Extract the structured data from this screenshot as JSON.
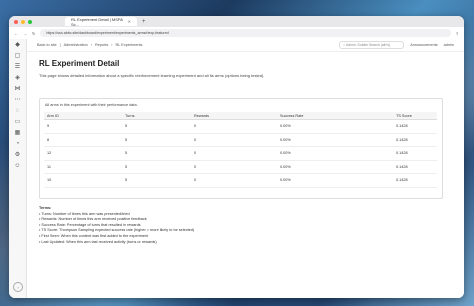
{
  "browser": {
    "tab_title": "RL Experiment Detail | MSPA Sc...",
    "url": "https://sso.abbc.site/dashboard/experiment/experiments_arms/rlexp-featured"
  },
  "nav": {
    "back": "Back to site",
    "breadcrumbs": [
      "Administration",
      "Reports",
      "RL Experiments"
    ],
    "search_placeholder": "Admin: Soldier Search (alt+s)",
    "announcements": "Announcements",
    "user": "admin"
  },
  "page": {
    "title": "RL Experiment Detail",
    "description": "This page shows detailed information about a specific reinforcement learning experiment and all its arms (options being tested)."
  },
  "arms": {
    "description": "All arms in this experiment with their performance data.",
    "columns": [
      "Arm ID",
      "Turns",
      "Rewards",
      "Success Rate",
      "TS Score"
    ],
    "rows": [
      [
        "9",
        "5",
        "0",
        "0.00%",
        "0.1428"
      ],
      [
        "8",
        "5",
        "0",
        "0.00%",
        "0.1428"
      ],
      [
        "12",
        "5",
        "0",
        "0.00%",
        "0.1428"
      ],
      [
        "11",
        "5",
        "0",
        "0.00%",
        "0.1428"
      ],
      [
        "10",
        "5",
        "0",
        "0.00%",
        "0.1428"
      ]
    ]
  },
  "terms": {
    "heading": "Terms:",
    "items": [
      "• Turns: Number of times this arm was presented/tried",
      "• Rewards: Number of times this arm received positive feedback",
      "• Success Rate: Percentage of turns that resulted in rewards",
      "• TS Score: Thompson Sampling expected success rate (higher = more likely to be selected)",
      "• First Seen: When this content was first added to the experiment",
      "• Last Updated: When this arm last received activity (turns or rewards)"
    ]
  }
}
